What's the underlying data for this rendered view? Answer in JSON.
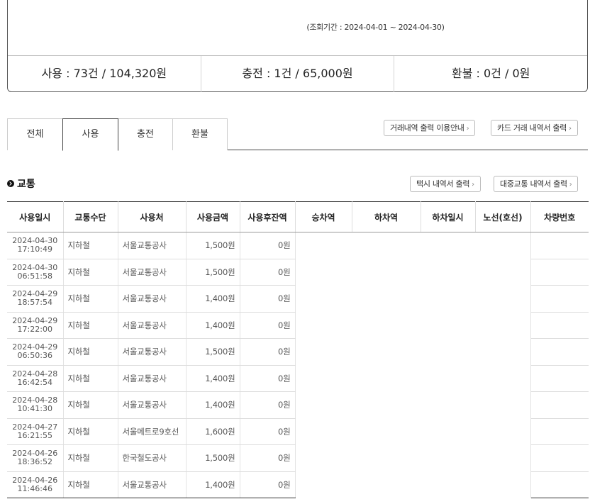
{
  "summary": {
    "period": "(조회기간 : 2024-04-01 ~ 2024-04-30)",
    "use": "사용 : 73건 / 104,320원",
    "charge": "충전 : 1건 / 65,000원",
    "refund": "환불 : 0건 / 0원"
  },
  "tabs": [
    {
      "label": "전체",
      "active": false
    },
    {
      "label": "사용",
      "active": true
    },
    {
      "label": "충전",
      "active": false
    },
    {
      "label": "환불",
      "active": false
    }
  ],
  "buttons": {
    "print_guide": "거래내역 출력 이용안내",
    "card_statement": "카드 거래 내역서 출력",
    "taxi_statement": "택시 내역서 출력",
    "public_transit_statement": "대중교통 내역서 출력"
  },
  "section": {
    "title": "교통"
  },
  "table": {
    "headers": [
      "사용일시",
      "교통수단",
      "사용처",
      "사용금액",
      "사용후잔액",
      "승차역",
      "하차역",
      "하차일시",
      "노선(호선)",
      "차량번호"
    ],
    "rows": [
      {
        "date": "2024-04-30",
        "time": "17:10:49",
        "mode": "지하철",
        "place": "서울교통공사",
        "amount": "1,500원",
        "balance": "0원"
      },
      {
        "date": "2024-04-30",
        "time": "06:51:58",
        "mode": "지하철",
        "place": "서울교통공사",
        "amount": "1,500원",
        "balance": "0원"
      },
      {
        "date": "2024-04-29",
        "time": "18:57:54",
        "mode": "지하철",
        "place": "서울교통공사",
        "amount": "1,400원",
        "balance": "0원"
      },
      {
        "date": "2024-04-29",
        "time": "17:22:00",
        "mode": "지하철",
        "place": "서울교통공사",
        "amount": "1,400원",
        "balance": "0원"
      },
      {
        "date": "2024-04-29",
        "time": "06:50:36",
        "mode": "지하철",
        "place": "서울교통공사",
        "amount": "1,500원",
        "balance": "0원"
      },
      {
        "date": "2024-04-28",
        "time": "16:42:54",
        "mode": "지하철",
        "place": "서울교통공사",
        "amount": "1,400원",
        "balance": "0원"
      },
      {
        "date": "2024-04-28",
        "time": "10:41:30",
        "mode": "지하철",
        "place": "서울교통공사",
        "amount": "1,400원",
        "balance": "0원"
      },
      {
        "date": "2024-04-27",
        "time": "16:21:55",
        "mode": "지하철",
        "place": "서울메트로9호선",
        "amount": "1,600원",
        "balance": "0원"
      },
      {
        "date": "2024-04-26",
        "time": "18:36:52",
        "mode": "지하철",
        "place": "한국철도공사",
        "amount": "1,500원",
        "balance": "0원"
      },
      {
        "date": "2024-04-26",
        "time": "11:46:46",
        "mode": "지하철",
        "place": "서울교통공사",
        "amount": "1,400원",
        "balance": "0원"
      }
    ]
  }
}
